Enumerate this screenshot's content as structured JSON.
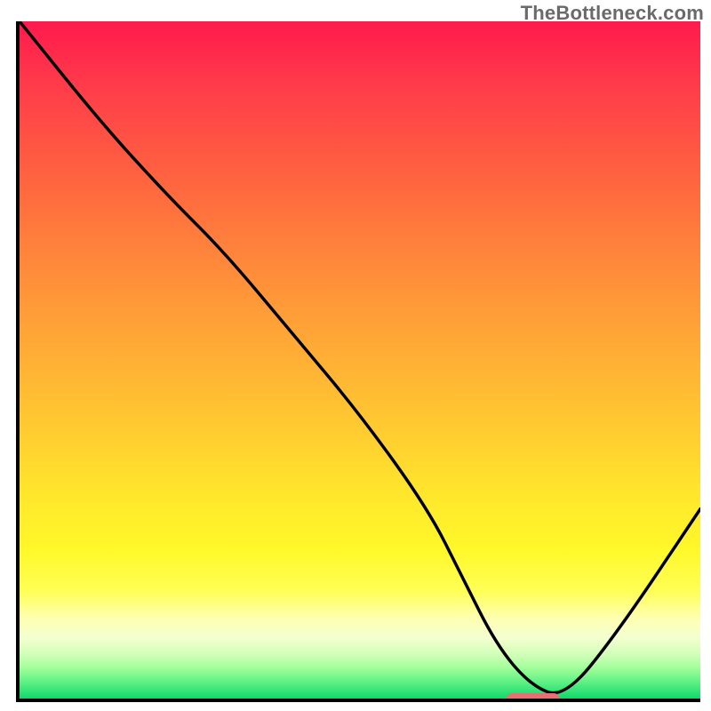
{
  "watermark": "TheBottleneck.com",
  "chart_data": {
    "type": "line",
    "title": "",
    "xlabel": "",
    "ylabel": "",
    "xlim": [
      0,
      100
    ],
    "ylim": [
      0,
      100
    ],
    "grid": false,
    "series": [
      {
        "name": "bottleneck-curve",
        "x": [
          0,
          12,
          22,
          30,
          40,
          50,
          60,
          65,
          70,
          75,
          80,
          88,
          100
        ],
        "values": [
          100,
          85,
          74,
          66,
          54,
          42,
          28,
          18,
          8,
          2,
          0,
          10,
          28
        ]
      }
    ],
    "annotations": [
      {
        "name": "optimal-marker",
        "shape": "pill",
        "color": "#e87072",
        "x_start": 71,
        "x_end": 79,
        "y": 0
      }
    ],
    "background": {
      "type": "vertical-gradient",
      "stops": [
        {
          "pos": 0.0,
          "color": "#ff1a4d"
        },
        {
          "pos": 0.5,
          "color": "#ffb030"
        },
        {
          "pos": 0.8,
          "color": "#fffb30"
        },
        {
          "pos": 1.0,
          "color": "#10d86c"
        }
      ]
    }
  }
}
